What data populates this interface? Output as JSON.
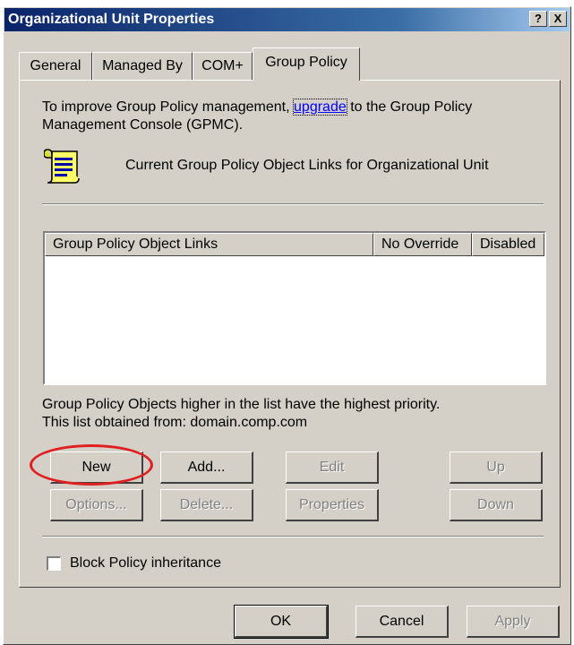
{
  "window": {
    "title": "Organizational Unit Properties",
    "help_label": "?",
    "close_label": "X"
  },
  "tabs": [
    {
      "label": "General",
      "active": false
    },
    {
      "label": "Managed By",
      "active": false
    },
    {
      "label": "COM+",
      "active": false
    },
    {
      "label": "Group Policy",
      "active": true
    }
  ],
  "info": {
    "text_before": "To improve Group Policy management,",
    "link": "upgrade",
    "text_after": "to the Group Policy",
    "line2": "Management Console (GPMC)."
  },
  "current_links_label": "Current Group Policy Object Links for Organizational Unit",
  "list": {
    "columns": [
      "Group Policy Object Links",
      "No Override",
      "Disabled"
    ],
    "rows": []
  },
  "priority_note": "Group Policy Objects higher in the list have the highest priority.",
  "source_note": "This list obtained from: domain.comp.com",
  "buttons": {
    "new": "New",
    "add": "Add...",
    "edit": "Edit",
    "up": "Up",
    "options": "Options...",
    "delete": "Delete...",
    "properties": "Properties",
    "down": "Down"
  },
  "block_inheritance": {
    "label": "Block Policy inheritance",
    "checked": false
  },
  "footer": {
    "ok": "OK",
    "cancel": "Cancel",
    "apply": "Apply"
  },
  "annotation_color": "#e02020"
}
